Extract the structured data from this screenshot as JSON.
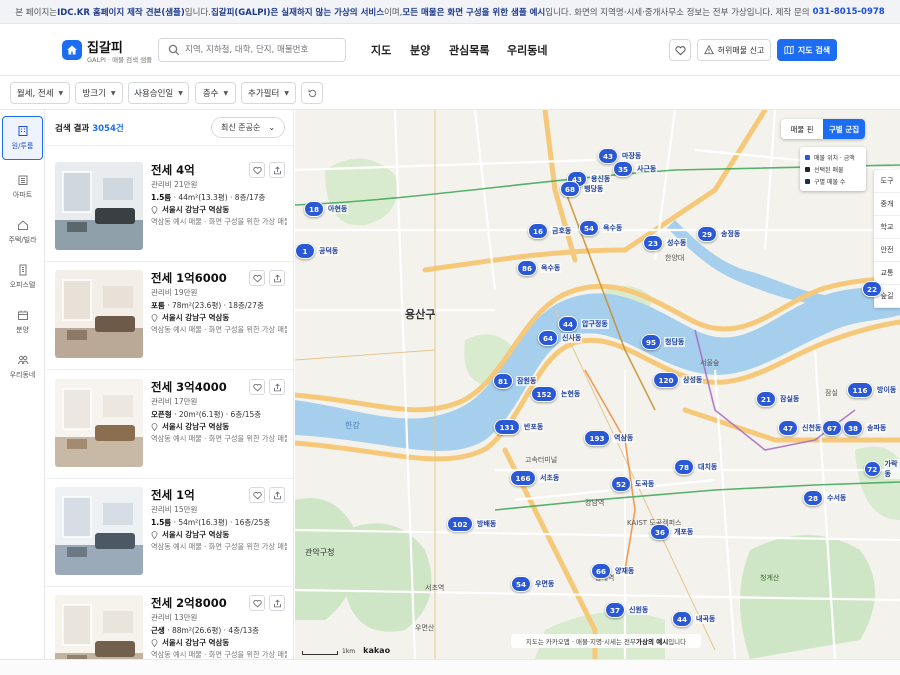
{
  "notice": {
    "t1": "본 페이지는 ",
    "b1": "IDC.KR 홈페이지 제작 견본(샘플)",
    "t2": "입니다. ",
    "b2": "집갈피(GALPI)은 실재하지 않는 가상의 서비스",
    "t3": "이며, ",
    "b3": "모든 매물은 화면 구성을 위한 샘플 예시",
    "t4": "입니다. 화면의 지역명·시세·중개사무소 정보는 전부 가상입니다. 제작 문의 ",
    "phone": "031-8015-0978"
  },
  "logo": {
    "name": "집갈피",
    "sub": "GALPI · 매물 검색 샘플"
  },
  "search": {
    "placeholder": "지역, 지하철, 대학, 단지, 매물번호"
  },
  "nav": [
    "지도",
    "분양",
    "관심목록",
    "우리동네"
  ],
  "header_buttons": {
    "report": "허위매물 신고",
    "map_search": "지도 검색"
  },
  "filters": [
    "월세, 전세",
    "방크기",
    "사용승인일",
    "층수",
    "추가필터"
  ],
  "rail": [
    "원/투룸",
    "아파트",
    "주택/빌라",
    "오피스텔",
    "분양",
    "우리동네"
  ],
  "list": {
    "label": "검색 결과",
    "count": "3054건",
    "sort": "최신 준공순"
  },
  "listings": [
    {
      "price": "전세 4억",
      "fee": "관리비 21만원",
      "type": "1.5룸",
      "spec": " · 44m²(13.3평) · 8층/17층",
      "loc": "서울시 강남구 역삼동",
      "desc": "역삼동 예시 매물 · 화면 구성을 위한 가상 매물"
    },
    {
      "price": "전세 1억6000",
      "fee": "관리비 19만원",
      "type": "포룸",
      "spec": " · 78m²(23.6평) · 18층/27층",
      "loc": "서울시 강남구 역삼동",
      "desc": "역삼동 예시 매물 · 화면 구성을 위한 가상 매물"
    },
    {
      "price": "전세 3억4000",
      "fee": "관리비 17만원",
      "type": "오픈형",
      "spec": " · 20m²(6.1평) · 6층/15층",
      "loc": "서울시 강남구 역삼동",
      "desc": "역삼동 예시 매물 · 화면 구성을 위한 가상 매물"
    },
    {
      "price": "전세 1억",
      "fee": "관리비 15만원",
      "type": "1.5룸",
      "spec": " · 54m²(16.3평) · 16층/25층",
      "loc": "서울시 강남구 역삼동",
      "desc": "역삼동 예시 매물 · 화면 구성을 위한 가상 매물"
    },
    {
      "price": "전세 2억8000",
      "fee": "관리비 13만원",
      "type": "근생",
      "spec": " · 88m²(26.6평) · 4층/13층",
      "loc": "서울시 강남구 역삼동",
      "desc": "역삼동 예시 매물 · 화면 구성을 위한 가상 매물"
    }
  ],
  "map": {
    "toggle": [
      "매물 핀",
      "구별 군집"
    ],
    "legend": [
      "매물 위치 · 금액",
      "선택된 매물",
      "구별 매물 수"
    ],
    "poi": [
      "도구",
      "중개",
      "학교",
      "안전",
      "교통",
      "숲길"
    ],
    "caption_a": "지도는 카카오맵 · 매물·지명·시세는 전부 ",
    "caption_b": "가상의 예시",
    "caption_c": "입니다",
    "scale": "1km",
    "brand": "kakao",
    "district": "용산구",
    "clusters": [
      {
        "n": "43",
        "label": "마장동"
      },
      {
        "n": "35",
        "label": "사근동"
      },
      {
        "n": "43",
        "label": "용신동"
      },
      {
        "n": "68",
        "label": "행당동"
      },
      {
        "n": "18",
        "label": "아현동"
      },
      {
        "n": "16",
        "label": "금호동"
      },
      {
        "n": "54",
        "label": "옥수동"
      },
      {
        "n": "29",
        "label": "송정동"
      },
      {
        "n": "23",
        "label": "성수동"
      },
      {
        "n": "1",
        "label": "공덕동"
      },
      {
        "n": "86",
        "label": "옥수동"
      },
      {
        "n": "22",
        "label": ""
      },
      {
        "n": "44",
        "label": "압구정동"
      },
      {
        "n": "64",
        "label": "신사동"
      },
      {
        "n": "95",
        "label": "청담동"
      },
      {
        "n": "81",
        "label": "잠원동"
      },
      {
        "n": "120",
        "label": "삼성동"
      },
      {
        "n": "116",
        "label": "방이동"
      },
      {
        "n": "152",
        "label": "논현동"
      },
      {
        "n": "21",
        "label": "잠실동"
      },
      {
        "n": "131",
        "label": "반포동"
      },
      {
        "n": "193",
        "label": "역삼동"
      },
      {
        "n": "47",
        "label": "신천동"
      },
      {
        "n": "67",
        "label": ""
      },
      {
        "n": "38",
        "label": "송파동"
      },
      {
        "n": "78",
        "label": "대치동"
      },
      {
        "n": "72",
        "label": "가락동"
      },
      {
        "n": "166",
        "label": "서초동"
      },
      {
        "n": "52",
        "label": "도곡동"
      },
      {
        "n": "28",
        "label": "수서동"
      },
      {
        "n": "102",
        "label": "방배동"
      },
      {
        "n": "36",
        "label": "개포동"
      },
      {
        "n": "66",
        "label": "양재동"
      },
      {
        "n": "54",
        "label": "우면동"
      },
      {
        "n": "37",
        "label": "신원동"
      },
      {
        "n": "44",
        "label": "내곡동"
      }
    ],
    "places": [
      "서울숲",
      "한양대",
      "용산구",
      "한강",
      "잠실",
      "고속터미널",
      "강남역",
      "서초역",
      "양재역",
      "KAIST 도곡캠퍼스",
      "우면산",
      "관악구청",
      "청계산"
    ]
  },
  "colors": {
    "accent": "#1d6df2",
    "cluster": "#2b59d6",
    "water": "#a6cfee",
    "park": "#cfe6c6",
    "road": "#f6c97a"
  }
}
